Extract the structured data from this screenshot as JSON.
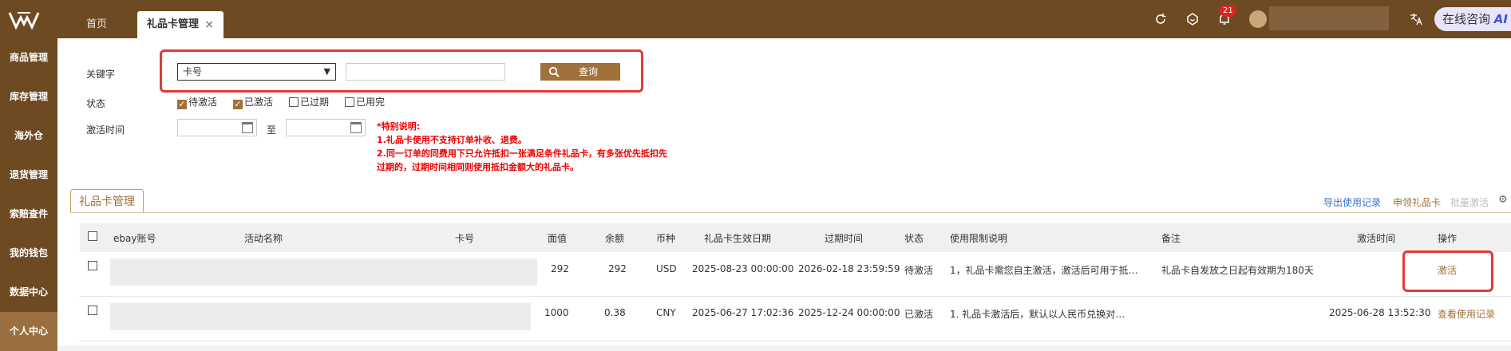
{
  "header": {
    "tabs": [
      {
        "label": "首页"
      },
      {
        "label": "礼品卡管理",
        "close": "×"
      }
    ],
    "badge_count": "21",
    "consult_label": "在线咨询",
    "consult_ai": "AI"
  },
  "sidebar": {
    "items": [
      {
        "label": "商品管理"
      },
      {
        "label": "库存管理"
      },
      {
        "label": "海外仓"
      },
      {
        "label": "退货管理"
      },
      {
        "label": "索赔查件"
      },
      {
        "label": "我的钱包"
      },
      {
        "label": "数据中心"
      },
      {
        "label": "个人中心"
      }
    ]
  },
  "filters": {
    "keyword_label": "关键字",
    "keyword_select_value": "卡号",
    "search_button": "查询",
    "status_label": "状态",
    "status_options": [
      {
        "label": "待激活",
        "checked": true
      },
      {
        "label": "已激活",
        "checked": true
      },
      {
        "label": "已过期",
        "checked": false
      },
      {
        "label": "已用完",
        "checked": false
      }
    ],
    "activation_time_label": "激活时间",
    "to_label": "至"
  },
  "notes": {
    "title": "*特别说明:",
    "line1": "1.礼品卡使用不支持订单补收、退费。",
    "line2": "2.同一订单的同费用下只允许抵扣一张满足条件礼品卡，有多张优先抵扣先",
    "line3": "过期的，过期时间相同则使用抵扣金额大的礼品卡。"
  },
  "section": {
    "tab_label": "礼品卡管理",
    "actions": [
      "导出使用记录",
      "申领礼品卡",
      "批量激活"
    ],
    "gear_icon": "gear-icon"
  },
  "table": {
    "headers": [
      "ebay账号",
      "活动名称",
      "卡号",
      "面值",
      "余额",
      "币种",
      "礼品卡生效日期",
      "过期时间",
      "状态",
      "使用限制说明",
      "备注",
      "激活时间",
      "操作"
    ],
    "rows": [
      {
        "face_value": "292",
        "balance": "292",
        "currency": "USD",
        "effective_date": "2025-08-23 00:00:00",
        "expire_time": "2026-02-18 23:59:59",
        "status": "待激活",
        "limit_desc": "1，礼品卡需您自主激活，激活后可用于抵…",
        "remark": "礼品卡自发放之日起有效期为180天",
        "activate_time": "",
        "action": "激活"
      },
      {
        "face_value": "1000",
        "balance": "0.38",
        "currency": "CNY",
        "effective_date": "2025-06-27 17:02:36",
        "expire_time": "2025-12-24 00:00:00",
        "status": "已激活",
        "limit_desc": "1. 礼品卡激活后，默认以人民币兑换对…",
        "remark": "",
        "activate_time": "2025-06-28 13:52:30",
        "action": "查看使用记录"
      }
    ]
  },
  "colors": {
    "brand_dark": "#6e4a22",
    "accent": "#a0713a",
    "highlight_red": "#e53935",
    "note_red": "#e00000"
  }
}
